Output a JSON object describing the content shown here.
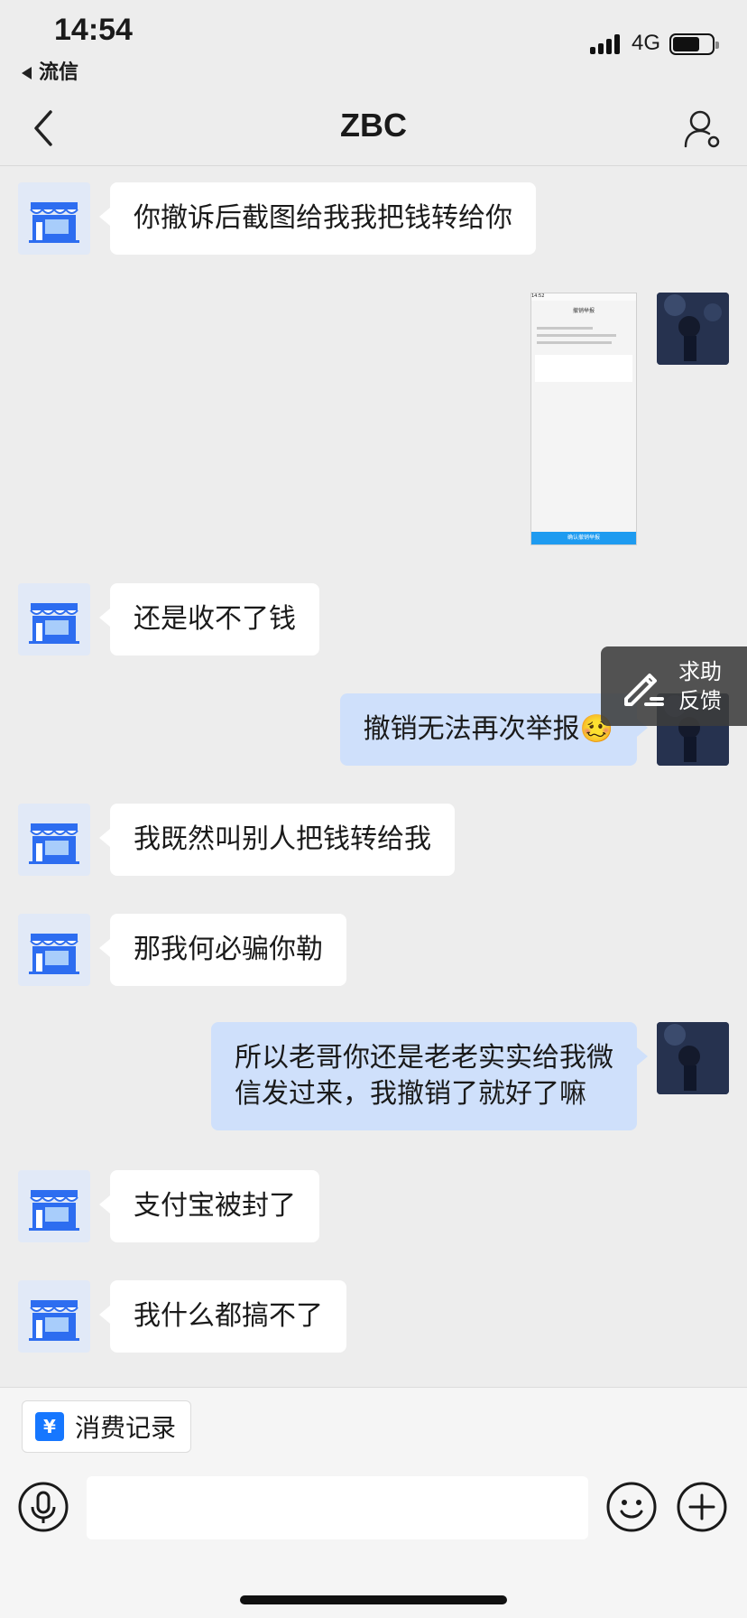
{
  "status_bar": {
    "time": "14:54",
    "back_app": "流信",
    "network": "4G"
  },
  "nav": {
    "title": "ZBC",
    "back_icon": "chevron-left-icon",
    "profile_icon": "user-settings-icon"
  },
  "messages": [
    {
      "from": "shop",
      "text": "你撤诉后截图给我我把钱转给你"
    },
    {
      "from": "me",
      "type": "image",
      "preview": {
        "time": "14:52",
        "title": "撤销举报",
        "button": "确认撤销举报"
      }
    },
    {
      "from": "shop",
      "text": "还是收不了钱"
    },
    {
      "from": "me",
      "text": "撤销无法再次举报🥴"
    },
    {
      "from": "shop",
      "text": "我既然叫别人把钱转给我"
    },
    {
      "from": "shop",
      "text": "那我何必骗你勒"
    },
    {
      "from": "me",
      "line1": "所以老哥你还是老老实实给我微",
      "line2": "信发过来，我撤销了就好了嘛"
    },
    {
      "from": "shop",
      "text": "支付宝被封了"
    },
    {
      "from": "shop",
      "text": "我什么都搞不了"
    }
  ],
  "feedback": {
    "line1": "求助",
    "line2": "反馈",
    "icon": "pen-icon"
  },
  "bottom": {
    "record_label": "消费记录",
    "record_icon_glyph": "¥",
    "input_placeholder": "",
    "icons": [
      "microphone-icon",
      "emoji-icon",
      "plus-icon"
    ]
  },
  "colors": {
    "incoming_bubble": "#ffffff",
    "outgoing_bubble": "#cfe0fb",
    "accent": "#1677ff",
    "background": "#ededed"
  }
}
